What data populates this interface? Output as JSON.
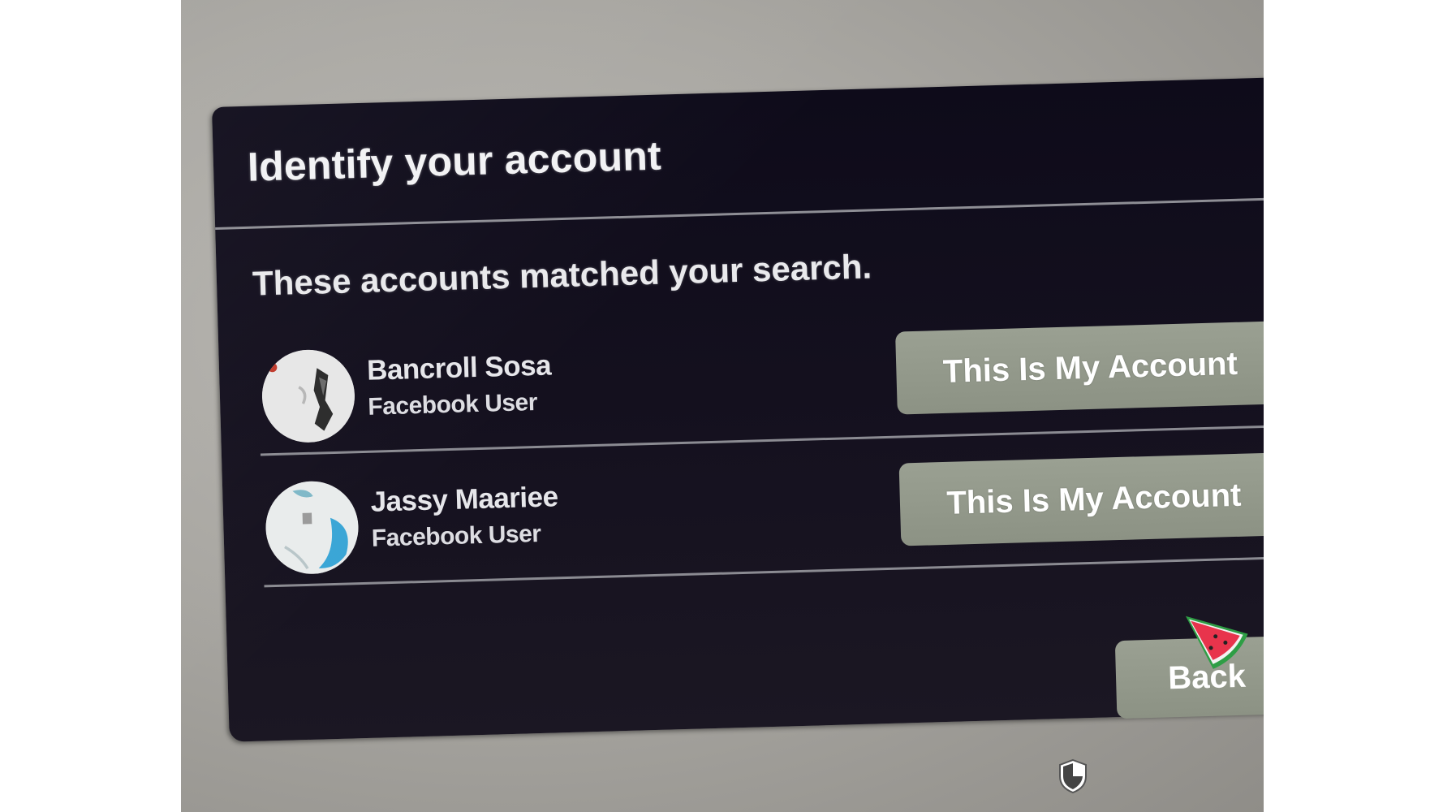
{
  "dialog": {
    "title": "Identify your account",
    "subtitle": "These accounts matched your search."
  },
  "accounts": [
    {
      "name": "Bancroll Sosa",
      "type": "Facebook User",
      "button_label": "This Is My Account"
    },
    {
      "name": "Jassy Maariee",
      "type": "Facebook User",
      "button_label": "This Is My Account"
    }
  ],
  "footer": {
    "back_label": "Back"
  },
  "colors": {
    "dialog_background": "#15111f",
    "button_background": "#9aa092",
    "button_text": "#ffffff",
    "title_text": "#f2f2f4",
    "divider": "#8e8e95"
  },
  "icons": {
    "cursor": "watermelon-cursor-icon",
    "overlay_badge": "shield-icon"
  }
}
